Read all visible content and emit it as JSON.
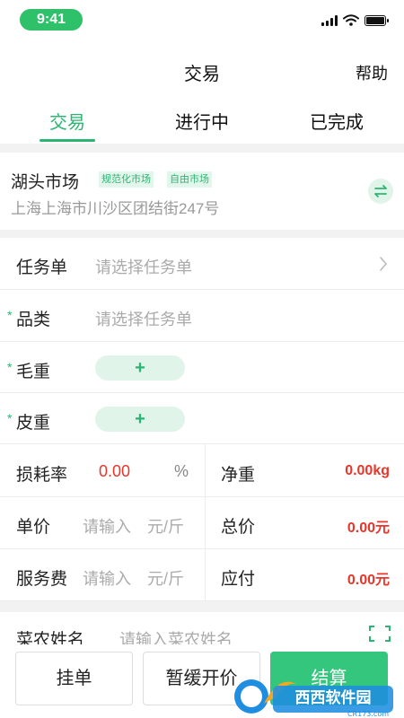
{
  "status_bar": {
    "time": "9:41"
  },
  "nav": {
    "title": "交易",
    "help": "帮助"
  },
  "tabs": [
    {
      "label": "交易",
      "active": true
    },
    {
      "label": "进行中",
      "active": false
    },
    {
      "label": "已完成",
      "active": false
    }
  ],
  "market": {
    "name": "湖头市场",
    "tags": [
      "规范化市场",
      "自由市场"
    ],
    "address": "上海上海市川沙区团结街247号"
  },
  "form": {
    "task": {
      "label": "任务单",
      "placeholder": "请选择任务单"
    },
    "category": {
      "required_mark": "*",
      "label": "品类",
      "placeholder": "请选择任务单"
    },
    "gross_weight": {
      "required_mark": "*",
      "label": "毛重",
      "add": "+"
    },
    "tare_weight": {
      "required_mark": "*",
      "label": "皮重",
      "add": "+"
    },
    "loss_rate": {
      "label": "损耗率",
      "value": "0.00",
      "unit": "%"
    },
    "net_weight": {
      "label": "净重",
      "value": "0.00kg"
    },
    "unit_price": {
      "label": "单价",
      "placeholder": "请输入",
      "unit": "元/斤"
    },
    "total_price": {
      "label": "总价",
      "value": "0.00元"
    },
    "service_fee": {
      "label": "服务费",
      "placeholder": "请输入",
      "unit": "元/斤"
    },
    "payable": {
      "label": "应付",
      "value": "0.00元"
    },
    "farmer": {
      "label": "菜农姓名",
      "placeholder": "请输入菜农姓名"
    }
  },
  "actions": {
    "hold": "挂单",
    "pause": "暂缓开价",
    "settle": "结算"
  },
  "watermark": {
    "text": "西西软件园",
    "sub": "CR173.com"
  },
  "colors": {
    "accent": "#2bb573",
    "primary_button": "#33c67c",
    "value_red": "#e8362a",
    "status_pill": "#2fc06a"
  }
}
